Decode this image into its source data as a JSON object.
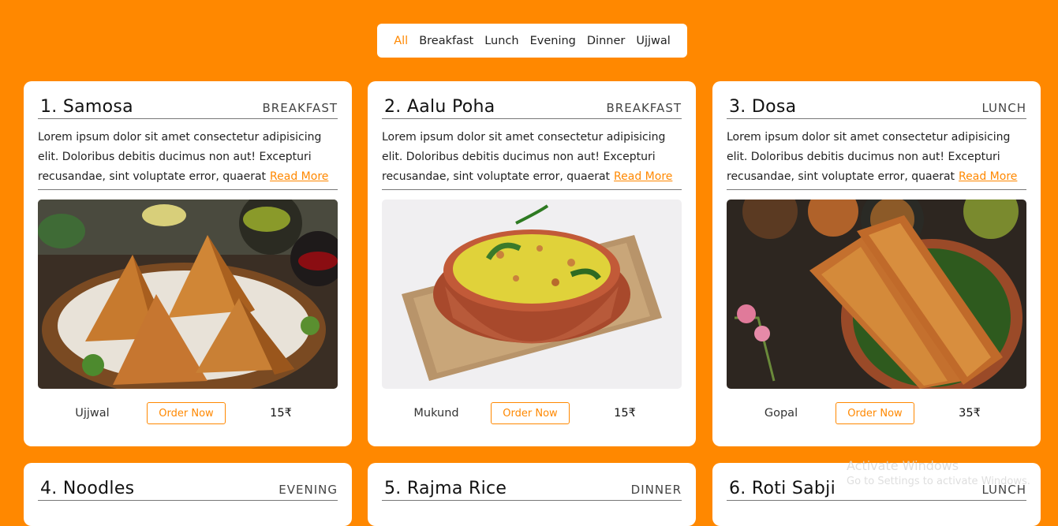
{
  "filters": [
    "All",
    "Breakfast",
    "Lunch",
    "Evening",
    "Dinner",
    "Ujjwal"
  ],
  "active_filter": "All",
  "accent_color": "#ff8800",
  "read_more_label": "Read More",
  "order_label": "Order Now",
  "description": "Lorem ipsum dolor sit amet consectetur adipisicing elit. Doloribus debitis ducimus non aut! Excepturi recusandae, sint voluptate error, quaerat",
  "desc_lines": [
    "Lorem ipsum dolor sit amet consectetur adipisicing",
    "elit. Doloribus debitis ducimus non aut! Excepturi",
    "recusandae, sint voluptate error, quaerat"
  ],
  "cards": [
    {
      "title": "1. Samosa",
      "category": "BREAKFAST",
      "chef": "Ujjwal",
      "price": "15₹",
      "image": "samosa-image"
    },
    {
      "title": "2. Aalu Poha",
      "category": "BREAKFAST",
      "chef": "Mukund",
      "price": "15₹",
      "image": "poha-image"
    },
    {
      "title": "3. Dosa",
      "category": "LUNCH",
      "chef": "Gopal",
      "price": "35₹",
      "image": "dosa-image"
    },
    {
      "title": "4. Noodles",
      "category": "EVENING"
    },
    {
      "title": "5. Rajma Rice",
      "category": "DINNER"
    },
    {
      "title": "6. Roti Sabji",
      "category": "LUNCH"
    }
  ],
  "watermark": {
    "title": "Activate Windows",
    "subtitle": "Go to Settings to activate Windows."
  }
}
